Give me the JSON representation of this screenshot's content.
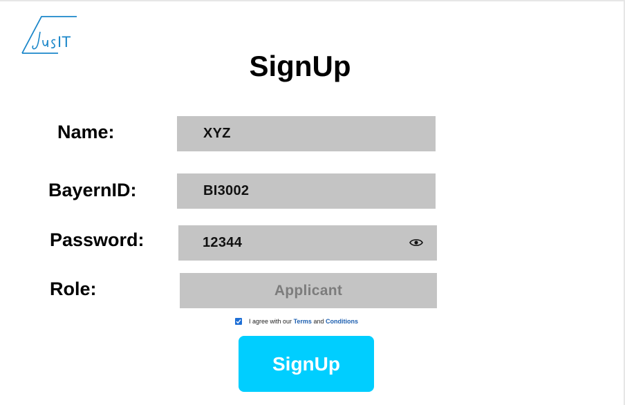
{
  "logo": {
    "text": "JusIT",
    "color": "#1a86c9"
  },
  "page": {
    "title": "SignUp"
  },
  "form": {
    "name": {
      "label": "Name:",
      "value": "XYZ"
    },
    "bayern_id": {
      "label": "BayernID:",
      "value": "BI3002"
    },
    "password": {
      "label": "Password:",
      "value": "12344",
      "toggle_icon": "eye-icon"
    },
    "role": {
      "label": "Role:",
      "value": "Applicant"
    },
    "agree": {
      "checked": true,
      "prefix": "I agree with our",
      "terms": "Terms",
      "and": "and",
      "conditions": "Conditions"
    },
    "submit_label": "SignUp"
  },
  "colors": {
    "field_bg": "#c4c4c4",
    "button_bg": "#00ceff",
    "link": "#1d5fb0",
    "checkbox": "#1e6fd6"
  }
}
